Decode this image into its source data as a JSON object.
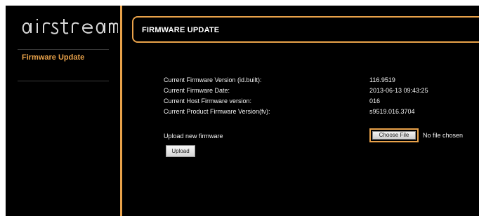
{
  "app": {
    "brand": "airstream"
  },
  "sidebar": {
    "items": [
      {
        "label": "Firmware Update"
      }
    ]
  },
  "header": {
    "title": "FIRMWARE UPDATE"
  },
  "firmware_info": [
    {
      "label": "Current Firmware Version (id.built):",
      "value": "116.9519"
    },
    {
      "label": "Current Firmware Date:",
      "value": "2013-06-13 09:43:25"
    },
    {
      "label": "Current Host Firmware version:",
      "value": "016"
    },
    {
      "label": "Current Product Firmware Version(fv):",
      "value": "s9519.016.3704"
    }
  ],
  "upload": {
    "label": "Upload new firmware",
    "choose_file_label": "Choose File",
    "file_status": "No file chosen",
    "upload_button_label": "Upload"
  },
  "colors": {
    "accent": "#e9a24a",
    "background": "#000000",
    "text": "#f2f2f2"
  }
}
